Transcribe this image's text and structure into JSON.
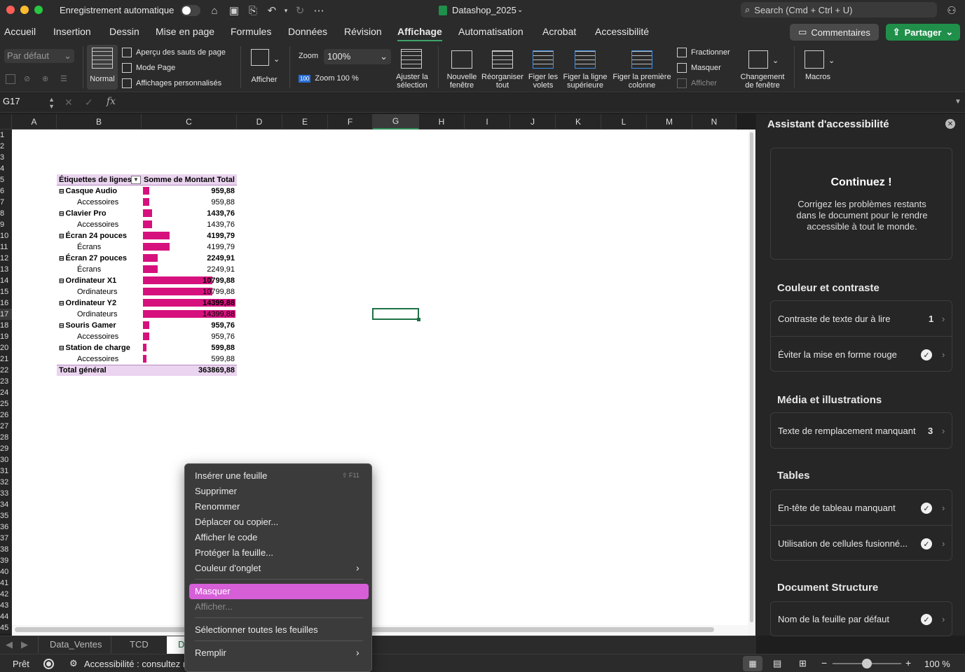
{
  "titlebar": {
    "autosave_label": "Enregistrement automatique",
    "doc_title": "Datashop_2025",
    "search_placeholder": "Search (Cmd + Ctrl + U)"
  },
  "menu_tabs": [
    "Accueil",
    "Insertion",
    "Dessin",
    "Mise en page",
    "Formules",
    "Données",
    "Révision",
    "Affichage",
    "Automatisation",
    "Acrobat",
    "Accessibilité"
  ],
  "active_tab": "Affichage",
  "buttons": {
    "comments": "Commentaires",
    "share": "Partager"
  },
  "ribbon": {
    "view_select": "Par défaut",
    "normal": "Normal",
    "page_break_preview": "Aperçu des sauts de page",
    "page_mode": "Mode Page",
    "custom_views": "Affichages personnalisés",
    "show": "Afficher",
    "zoom_label": "Zoom",
    "zoom_value": "100%",
    "zoom_100": "Zoom 100 %",
    "zoom_100_icon": "100",
    "fit_selection": "Ajuster la sélection",
    "new_window": "Nouvelle fenêtre",
    "arrange_all": "Réorganiser tout",
    "freeze_panes": "Figer les volets",
    "freeze_top_row": "Figer la ligne supérieure",
    "freeze_first_col": "Figer la première colonne",
    "split": "Fractionner",
    "hide": "Masquer",
    "unhide": "Afficher",
    "switch_window": "Changement de fenêtre",
    "macros": "Macros"
  },
  "formula_bar": {
    "name_box": "G17",
    "fx": "fx",
    "formula": ""
  },
  "columns": [
    "A",
    "B",
    "C",
    "D",
    "E",
    "F",
    "G",
    "H",
    "I",
    "J",
    "K",
    "L",
    "M",
    "N"
  ],
  "selected_column": "G",
  "rows": [
    "1",
    "2",
    "3",
    "4",
    "5",
    "6",
    "7",
    "8",
    "9",
    "10",
    "11",
    "12",
    "13",
    "14",
    "15",
    "16",
    "17",
    "18",
    "19",
    "20",
    "21",
    "22",
    "23",
    "24",
    "25",
    "26",
    "27",
    "28",
    "29",
    "30",
    "31",
    "32",
    "33",
    "34",
    "35",
    "36",
    "37",
    "38",
    "39",
    "40",
    "41",
    "42",
    "43",
    "44",
    "45"
  ],
  "pivot": {
    "header_labels": "Étiquettes de lignes",
    "header_sum": "Somme de Montant Total",
    "max_value": 14399.88,
    "rows": [
      {
        "label": "Casque Audio",
        "value": "959,88",
        "num": 959.88,
        "group": true
      },
      {
        "label": "Accessoires",
        "value": "959,88",
        "num": 959.88,
        "group": false
      },
      {
        "label": "Clavier Pro",
        "value": "1439,76",
        "num": 1439.76,
        "group": true
      },
      {
        "label": "Accessoires",
        "value": "1439,76",
        "num": 1439.76,
        "group": false
      },
      {
        "label": "Écran 24 pouces",
        "value": "4199,79",
        "num": 4199.79,
        "group": true
      },
      {
        "label": "Écrans",
        "value": "4199,79",
        "num": 4199.79,
        "group": false
      },
      {
        "label": "Écran 27 pouces",
        "value": "2249,91",
        "num": 2249.91,
        "group": true
      },
      {
        "label": "Écrans",
        "value": "2249,91",
        "num": 2249.91,
        "group": false
      },
      {
        "label": "Ordinateur X1",
        "value": "10799,88",
        "num": 10799.88,
        "group": true
      },
      {
        "label": "Ordinateurs",
        "value": "10799,88",
        "num": 10799.88,
        "group": false
      },
      {
        "label": "Ordinateur Y2",
        "value": "14399,88",
        "num": 14399.88,
        "group": true
      },
      {
        "label": "Ordinateurs",
        "value": "14399,88",
        "num": 14399.88,
        "group": false
      },
      {
        "label": "Souris Gamer",
        "value": "959,76",
        "num": 959.76,
        "group": true
      },
      {
        "label": "Accessoires",
        "value": "959,76",
        "num": 959.76,
        "group": false
      },
      {
        "label": "Station de charge",
        "value": "599,88",
        "num": 599.88,
        "group": true
      },
      {
        "label": "Accessoires",
        "value": "599,88",
        "num": 599.88,
        "group": false
      }
    ],
    "total_label": "Total général",
    "total_value": "363869,88"
  },
  "panel": {
    "title": "Assistant d'accessibilité",
    "card_title": "Continuez !",
    "card_text": "Corrigez les problèmes restants dans le document pour le rendre accessible à tout le monde.",
    "sec_color": "Couleur et contraste",
    "item_contrast": "Contraste de texte dur à lire",
    "item_contrast_count": "1",
    "item_red": "Éviter la mise en forme rouge",
    "sec_media": "Média et illustrations",
    "item_alt": "Texte de remplacement manquant",
    "item_alt_count": "3",
    "sec_tables": "Tables",
    "item_header": "En-tête de tableau manquant",
    "item_merged": "Utilisation de cellules fusionné...",
    "sec_doc": "Document Structure",
    "item_sheetname": "Nom de la feuille par défaut"
  },
  "sheet_tabs": {
    "tab1": "Data_Ventes",
    "tab2": "TCD",
    "tab3": "D"
  },
  "status": {
    "ready": "Prêt",
    "accessibility": "Accessibilité : consultez r",
    "zoom": "100 %",
    "zoom_level": 0.5
  },
  "context_menu": {
    "insert": "Insérer une feuille",
    "insert_shortcut": "⇧ F11",
    "delete": "Supprimer",
    "rename": "Renommer",
    "move_copy": "Déplacer ou copier...",
    "view_code": "Afficher le code",
    "protect": "Protéger la feuille...",
    "tab_color": "Couleur d'onglet",
    "hide": "Masquer",
    "unhide": "Afficher...",
    "select_all": "Sélectionner toutes les feuilles",
    "fill": "Remplir"
  },
  "colors": {
    "accent": "#1f8f4a",
    "pivot_bar": "#d6117e",
    "pivot_header": "#ead4ef",
    "menu_highlight": "#d65fd8"
  }
}
